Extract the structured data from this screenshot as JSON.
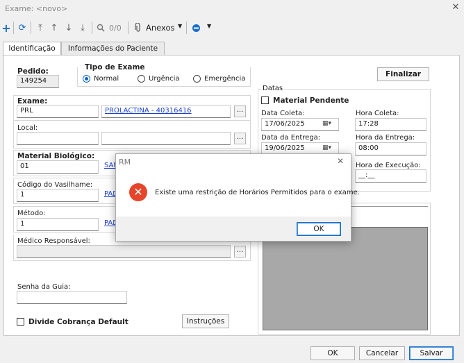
{
  "window": {
    "title": "Exame: <novo>",
    "close_icon": "close-icon"
  },
  "toolbar": {
    "search_counter": "0/0",
    "anexos_label": "Anexos"
  },
  "tabs": [
    {
      "label": "Identificação"
    },
    {
      "label": "Informações do Paciente"
    }
  ],
  "pedido": {
    "label": "Pedido:",
    "value": "149254"
  },
  "tipo_exame": {
    "label": "Tipo de Exame",
    "options": [
      "Normal",
      "Urgência",
      "Emergência"
    ],
    "selected": "Normal"
  },
  "finalizar_label": "Finalizar",
  "exame": {
    "label": "Exame:",
    "code": "PRL",
    "link": "PROLACTINA - 40316416"
  },
  "local": {
    "label": "Local:"
  },
  "material": {
    "label": "Material Biológico:",
    "code": "01",
    "link": "SAN"
  },
  "vasilhame": {
    "label": "Código do Vasilhame:",
    "code": "1",
    "link": "PAD"
  },
  "metodo": {
    "label": "Método:",
    "code": "1",
    "link": "PAD"
  },
  "medico": {
    "label": "Médico Responsável:"
  },
  "senha": {
    "label": "Senha da Guia:"
  },
  "divide_cobranca": {
    "label": "Divide Cobrança Default",
    "checked": false
  },
  "instrucoes_label": "Instruções",
  "datas": {
    "group_label": "Datas",
    "material_pendente": "Material Pendente",
    "data_coleta_label": "Data Coleta:",
    "data_coleta": "17/06/2025",
    "hora_coleta_label": "Hora Coleta:",
    "hora_coleta": "17:28",
    "data_entrega_label": "Data da Entrega:",
    "data_entrega": "19/06/2025",
    "hora_entrega_label": "Hora da Entrega:",
    "hora_entrega": "08:00",
    "hora_execucao_label": "Hora de Execução:",
    "hora_execucao": "__:__"
  },
  "footer": {
    "ok": "OK",
    "cancelar": "Cancelar",
    "salvar": "Salvar"
  },
  "dialog": {
    "title": "RM",
    "message": "Existe uma restrição de Horários Permitidos para o exame.",
    "ok": "OK",
    "error_color": "#e5452a"
  }
}
